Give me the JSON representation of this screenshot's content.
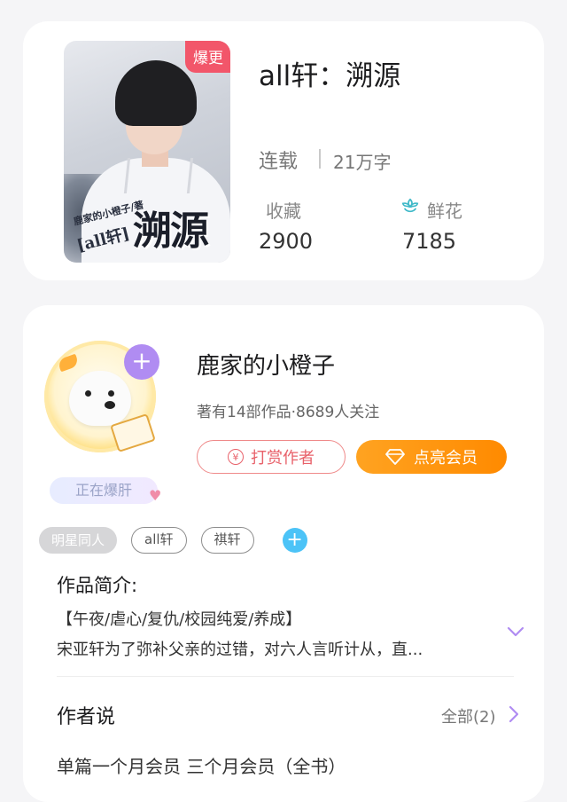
{
  "book": {
    "cover_badge": "爆更",
    "cover_title": "溯源",
    "cover_author": "鹿家的小橙子/著",
    "cover_tag": "[all轩]",
    "title": "all轩：溯源",
    "status": "连载",
    "word_count": "21万字",
    "favorites_label": "收藏",
    "favorites_value": "2900",
    "flowers_label": "鲜花",
    "flowers_value": "7185"
  },
  "author": {
    "name": "鹿家的小橙子",
    "meta": "著有14部作品·8689人关注",
    "live_tag": "正在爆肝",
    "tip_button": "打赏作者",
    "vip_button": "点亮会员",
    "tags": [
      "明星同人",
      "all轩",
      "祺轩"
    ],
    "intro_heading": "作品简介:",
    "intro_tags": "【午夜/虐心/复仇/校园纯爱/养成】",
    "intro_text": "宋亚轩为了弥补父亲的过错，对六人言听计从，直...",
    "says_heading": "作者说",
    "says_all": "全部(2)",
    "says_first": "单篇一个月会员  三个月会员（全书）"
  },
  "colors": {
    "badge": "#f2566a",
    "vip_orange": "#ff9a12",
    "tip_red": "#e8616a",
    "plus_purple": "#b08cf2",
    "add_blue": "#4cc3f7",
    "flower_teal": "#3fb9c8"
  },
  "icons": {
    "flower": "flower-icon",
    "yen": "yen-icon",
    "diamond": "diamond-icon",
    "expand": "chevron-down-icon",
    "more": "chevron-right-icon"
  }
}
